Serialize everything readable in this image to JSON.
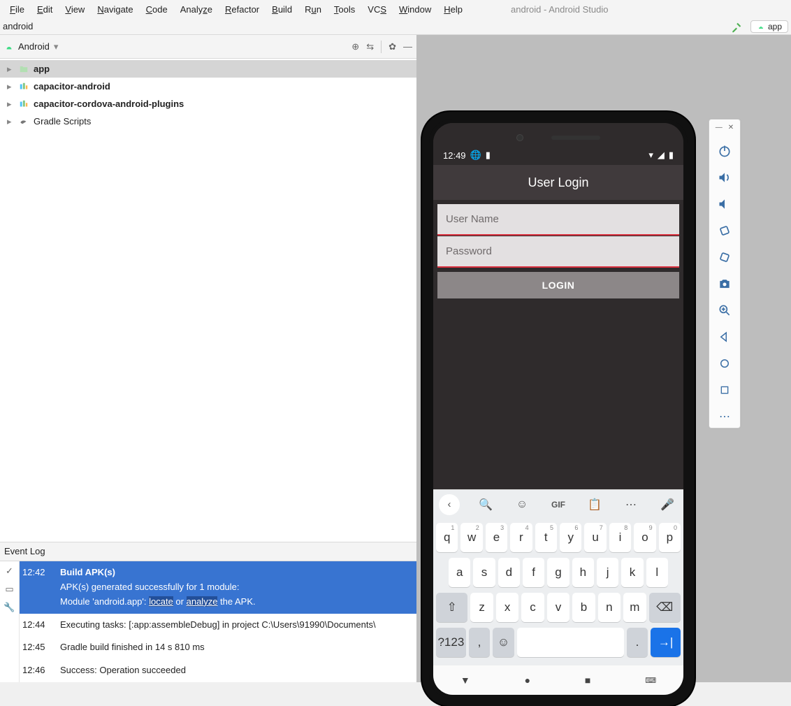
{
  "menubar": {
    "items": [
      "File",
      "Edit",
      "View",
      "Navigate",
      "Code",
      "Analyze",
      "Refactor",
      "Build",
      "Run",
      "Tools",
      "VCS",
      "Window",
      "Help"
    ],
    "title": "android - Android Studio"
  },
  "breadcrumb": {
    "text": "android",
    "right_chip": "app"
  },
  "project": {
    "mode": "Android",
    "tree": [
      {
        "label": "app",
        "bold": true,
        "icon": "folder",
        "sel": true
      },
      {
        "label": "capacitor-android",
        "bold": true,
        "icon": "module"
      },
      {
        "label": "capacitor-cordova-android-plugins",
        "bold": true,
        "icon": "module"
      },
      {
        "label": "Gradle Scripts",
        "bold": false,
        "icon": "gradle"
      }
    ]
  },
  "eventlog": {
    "title": "Event Log",
    "rows": [
      {
        "time": "12:42",
        "sel": true,
        "lines": [
          {
            "bold": true,
            "text": "Build APK(s)"
          },
          {
            "text": "APK(s) generated successfully for 1 module:"
          },
          {
            "html": "Module 'android.app': <span class='highlight'><a>locate</a></span> or <span class='highlight'><a>analyze</a></span> the APK."
          }
        ]
      },
      {
        "time": "12:44",
        "sel": false,
        "lines": [
          {
            "text": "Executing tasks: [:app:assembleDebug] in project C:\\Users\\91990\\Documents\\"
          }
        ]
      },
      {
        "time": "12:45",
        "sel": false,
        "lines": [
          {
            "text": "Gradle build finished in 14 s 810 ms"
          }
        ]
      },
      {
        "time": "12:46",
        "sel": false,
        "lines": [
          {
            "text": "Success: Operation succeeded"
          }
        ]
      }
    ]
  },
  "side_toolbar": [
    "power",
    "vol-up",
    "vol-down",
    "rotate-left",
    "rotate-right",
    "camera",
    "zoom",
    "back",
    "home",
    "overview",
    "more"
  ],
  "phone": {
    "status": {
      "time": "12:49"
    },
    "appbar": "User Login",
    "fields": {
      "user_ph": "User Name",
      "pass_ph": "Password"
    },
    "login_btn": "LOGIN",
    "kbd_bar": {
      "gif": "GIF"
    },
    "kbd": {
      "row1": [
        [
          "q",
          "1"
        ],
        [
          "w",
          "2"
        ],
        [
          "e",
          "3"
        ],
        [
          "r",
          "4"
        ],
        [
          "t",
          "5"
        ],
        [
          "y",
          "6"
        ],
        [
          "u",
          "7"
        ],
        [
          "i",
          "8"
        ],
        [
          "o",
          "9"
        ],
        [
          "p",
          "0"
        ]
      ],
      "row2": [
        "a",
        "s",
        "d",
        "f",
        "g",
        "h",
        "j",
        "k",
        "l"
      ],
      "row3": [
        "z",
        "x",
        "c",
        "v",
        "b",
        "n",
        "m"
      ],
      "sym": "?123",
      "comma": ",",
      "period": "."
    }
  }
}
